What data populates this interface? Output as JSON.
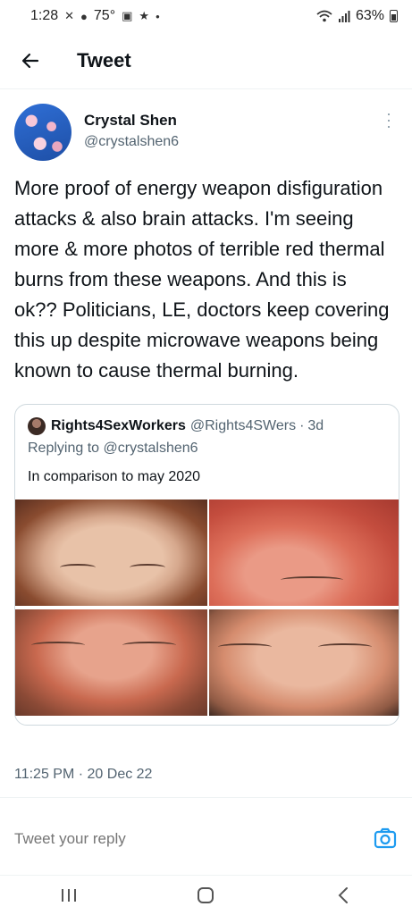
{
  "status_bar": {
    "time": "1:28",
    "temperature": "75°",
    "battery_percent": "63%",
    "battery_level": 0.63
  },
  "header": {
    "title": "Tweet"
  },
  "tweet": {
    "author_name": "Crystal Shen",
    "author_handle": "@crystalshen6",
    "text": "More proof of energy weapon disfiguration attacks & also brain attacks. I'm seeing more & more photos of terrible red thermal burns from these weapons. And this is ok?? Politicians, LE, doctors keep covering this up despite microwave weapons being known to cause thermal burning.",
    "timestamp": "11:25 PM · 20 Dec 22"
  },
  "quote": {
    "author_name": "Rights4SexWorkers",
    "author_handle": "@Rights4SWers",
    "separator": "·",
    "time": "3d",
    "replying_to": "Replying to @crystalshen6",
    "text": "In comparison to may 2020"
  },
  "reply_bar": {
    "placeholder": "Tweet your reply"
  },
  "icons": {
    "back": "arrow-left-icon",
    "more": "more-vertical-icon",
    "camera": "camera-icon",
    "nav_recents": "recents-icon",
    "nav_home": "home-icon",
    "nav_back": "back-chevron-icon"
  },
  "colors": {
    "accent": "#1d9bf0",
    "secondary_text": "#536471",
    "border": "#cfd9de"
  }
}
